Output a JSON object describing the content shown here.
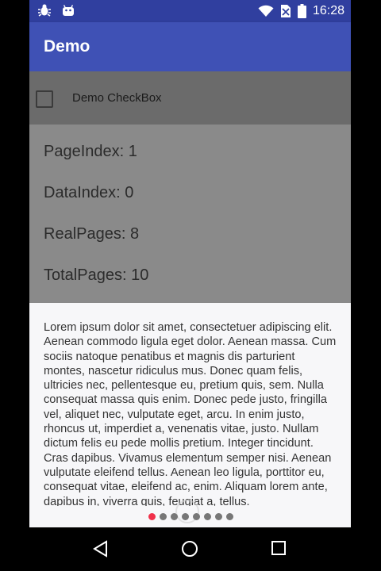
{
  "status_bar": {
    "time": "16:28",
    "left_icons": [
      "bug-icon",
      "android-icon"
    ],
    "right_icons": [
      "wifi-icon",
      "no-sim-icon",
      "battery-icon"
    ],
    "color": "#303f9f"
  },
  "app_bar": {
    "title": "Demo",
    "color": "#3f51b5"
  },
  "checkbox": {
    "label": "Demo CheckBox",
    "checked": false
  },
  "info": {
    "page_index": "PageIndex: 1",
    "data_index": "DataIndex: 0",
    "real_pages": "RealPages: 8",
    "total_pages": "TotalPages: 10"
  },
  "sheet": {
    "text": "Lorem ipsum dolor sit amet, consectetuer adipiscing elit. Aenean commodo ligula eget dolor. Aenean massa. Cum sociis natoque penatibus et magnis dis parturient montes, nascetur ridiculus mus. Donec quam felis, ultricies nec, pellentesque eu, pretium quis, sem. Nulla consequat massa quis enim. Donec pede justo, fringilla vel, aliquet nec, vulputate eget, arcu. In enim justo, rhoncus ut, imperdiet a, venenatis vitae, justo. Nullam dictum felis eu pede mollis pretium. Integer tincidunt. Cras dapibus. Vivamus elementum semper nisi. Aenean vulputate eleifend tellus. Aenean leo ligula, porttitor eu, consequat vitae, eleifend ac, enim. Aliquam lorem ante, dapibus in, viverra quis, feugiat a, tellus.",
    "page_count": 8,
    "active_page": 0,
    "active_color": "#f0304a"
  },
  "nav_bar": {
    "icons": [
      "back-icon",
      "home-icon",
      "recents-icon"
    ]
  }
}
